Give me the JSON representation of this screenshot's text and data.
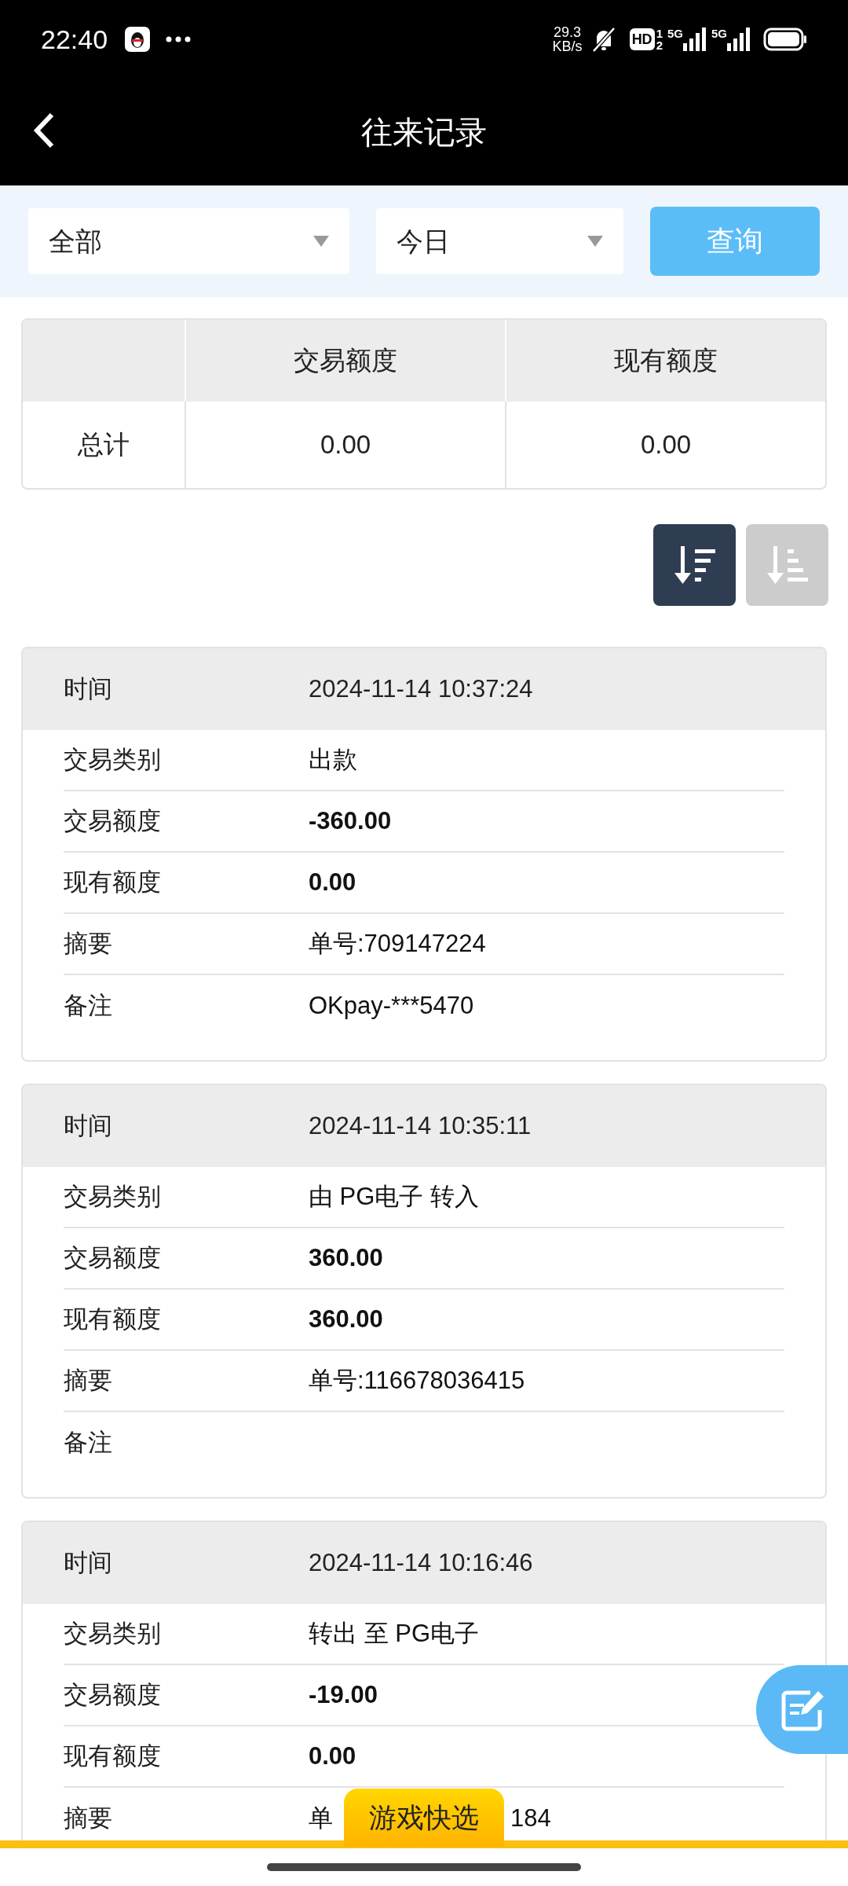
{
  "status_bar": {
    "time": "22:40",
    "speed": "29.3",
    "speed_unit": "KB/s",
    "hd": "HD",
    "sim_1": "1",
    "sim_2": "2",
    "network_1": "5G",
    "network_2": "5G"
  },
  "header": {
    "title": "往来记录"
  },
  "filters": {
    "type": "全部",
    "period": "今日",
    "query_button": "查询"
  },
  "summary": {
    "columns": [
      "交易额度",
      "现有额度"
    ],
    "row_label": "总计",
    "values": [
      "0.00",
      "0.00"
    ]
  },
  "sort_buttons": [
    {
      "selected": true
    },
    {
      "selected": false
    }
  ],
  "records": [
    {
      "time_label": "时间",
      "time": "2024-11-14 10:37:24",
      "rows": [
        {
          "label": "交易类别",
          "value": "出款",
          "kind": "text"
        },
        {
          "label": "交易额度",
          "value": "-360.00",
          "kind": "amount"
        },
        {
          "label": "现有额度",
          "value": "0.00",
          "kind": "amount"
        },
        {
          "label": "摘要",
          "value": "单号:709147224",
          "kind": "text"
        },
        {
          "label": "备注",
          "value": "OKpay-***5470",
          "kind": "text"
        }
      ]
    },
    {
      "time_label": "时间",
      "time": "2024-11-14 10:35:11",
      "rows": [
        {
          "label": "交易类别",
          "value": "由 PG电子 转入",
          "kind": "text"
        },
        {
          "label": "交易额度",
          "value": "360.00",
          "kind": "amount"
        },
        {
          "label": "现有额度",
          "value": "360.00",
          "kind": "amount"
        },
        {
          "label": "摘要",
          "value": "单号:116678036415",
          "kind": "text"
        },
        {
          "label": "备注",
          "kind": "text"
        }
      ]
    },
    {
      "time_label": "时间",
      "time": "2024-11-14 10:16:46",
      "rows": [
        {
          "label": "交易类别",
          "value": "转出 至 PG电子",
          "kind": "text"
        },
        {
          "label": "交易额度",
          "value": "-19.00",
          "kind": "amount"
        },
        {
          "label": "现有额度",
          "value": "0.00",
          "kind": "amount"
        },
        {
          "label": "摘要",
          "value_start": "单",
          "value_end": "184",
          "kind": "text"
        }
      ]
    }
  ],
  "quick_tab": {
    "label": "游戏快选"
  }
}
